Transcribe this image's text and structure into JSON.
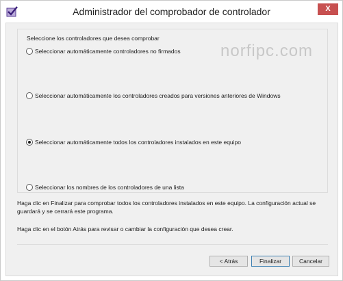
{
  "window": {
    "title": "Administrador del comprobador de controlador",
    "close_symbol": "X"
  },
  "group": {
    "title": "Seleccione los controladores que desea comprobar",
    "watermark": "norfipc.com"
  },
  "options": [
    {
      "label": "Seleccionar automáticamente controladores no firmados",
      "checked": false
    },
    {
      "label": "Seleccionar automáticamente los controladores creados para versiones anteriores de Windows",
      "checked": false
    },
    {
      "label": "Seleccionar automáticamente todos los controladores instalados en este equipo",
      "checked": true
    },
    {
      "label": "Seleccionar los nombres de los controladores de una lista",
      "checked": false
    }
  ],
  "info": {
    "line1": "Haga clic en Finalizar para comprobar todos los controladores instalados en este equipo. La configuración actual se guardará y se cerrará este programa.",
    "line2": "Haga clic en el botón Atrás para revisar o cambiar la configuración que desea crear."
  },
  "buttons": {
    "back": "< Atrás",
    "finish": "Finalizar",
    "cancel": "Cancelar"
  },
  "icons": {
    "app": "driver-verifier-checkmark-icon",
    "close": "close-icon"
  },
  "colors": {
    "close_button": "#c75050",
    "dialog_background": "#f0f0f0"
  }
}
